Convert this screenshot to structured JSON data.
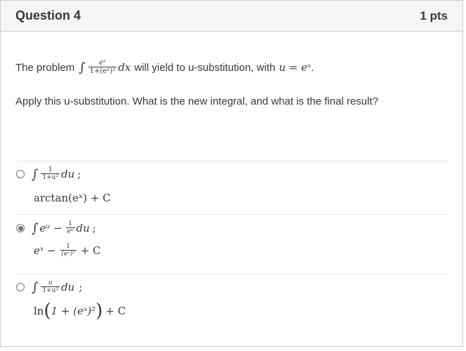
{
  "question": {
    "title": "Question 4",
    "points": "1 pts"
  },
  "prompt": {
    "text_before": "The problem",
    "integral_sign": "∫",
    "frac_num": "eˣ",
    "frac_den": "1+(eˣ)²",
    "dx": "dx",
    "text_middle": "will yield to u-substitution, with",
    "u_eq": "u = eˣ",
    "text_end": ".",
    "line2": "Apply this u-substitution. What is the new integral, and what is the final result?"
  },
  "answers": [
    {
      "selected": false,
      "integral_sign": "∫",
      "frac_num": "1",
      "frac_den": "1+u²",
      "du": "du",
      "sep": ";",
      "result": "arctan(eˣ) + C"
    },
    {
      "selected": true,
      "integral_sign": "∫",
      "pre": "eᵘ −",
      "frac_num": "1",
      "frac_den": "eᵘ",
      "du": "du",
      "sep": ";",
      "result_pre": "eˣ −",
      "result_frac_num": "1",
      "result_frac_den": "(eˣ)²",
      "result_post": "+ C"
    },
    {
      "selected": false,
      "integral_sign": "∫",
      "frac_num": "u",
      "frac_den": "1+u²",
      "du": "du",
      "sep": ";",
      "result_pre": "ln",
      "result_inner": "1 + (eˣ)²",
      "result_post": "+ C"
    }
  ]
}
